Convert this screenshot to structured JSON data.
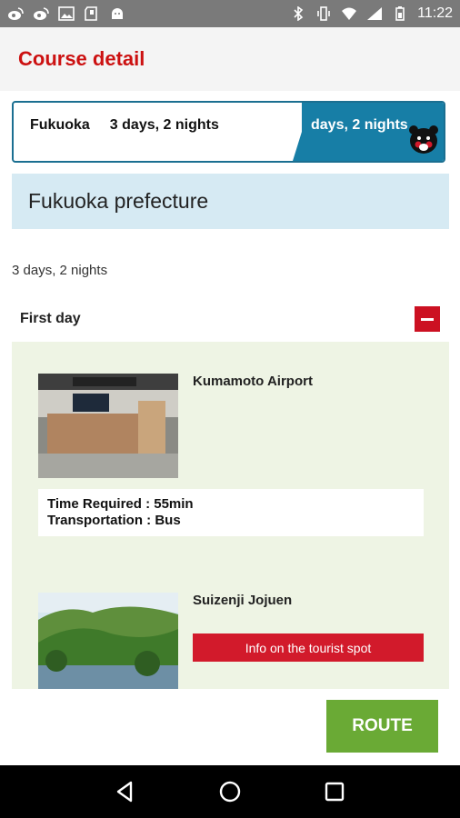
{
  "status_bar": {
    "time": "11:22",
    "left_icons": [
      "weibo-icon",
      "weibo-icon",
      "image-icon",
      "sd-card-icon",
      "android-icon"
    ],
    "right_icons": [
      "bluetooth-icon",
      "vibrate-icon",
      "wifi-icon",
      "signal-icon",
      "battery-icon"
    ]
  },
  "app_bar": {
    "title": "Course detail"
  },
  "banner": {
    "region": "Fukuoka",
    "duration": "3 days, 2 nights",
    "right_text": "days, 2 nights"
  },
  "region_header": "Fukuoka prefecture",
  "course_duration": "3 days, 2 nights",
  "day": {
    "label": "First day"
  },
  "spots": [
    {
      "name": "Kumamoto Airport",
      "time_required": "Time Required : 55min",
      "transportation": "Transportation : Bus"
    },
    {
      "name": "Suizenji Jojuen",
      "info_button": "Info on the tourist spot"
    }
  ],
  "route_button": "ROUTE",
  "colors": {
    "accent_red": "#cc1111",
    "banner_blue": "#177ea6",
    "route_green": "#6aaa35",
    "region_bg": "#d6eaf3",
    "course_bg": "#eef4e4"
  }
}
